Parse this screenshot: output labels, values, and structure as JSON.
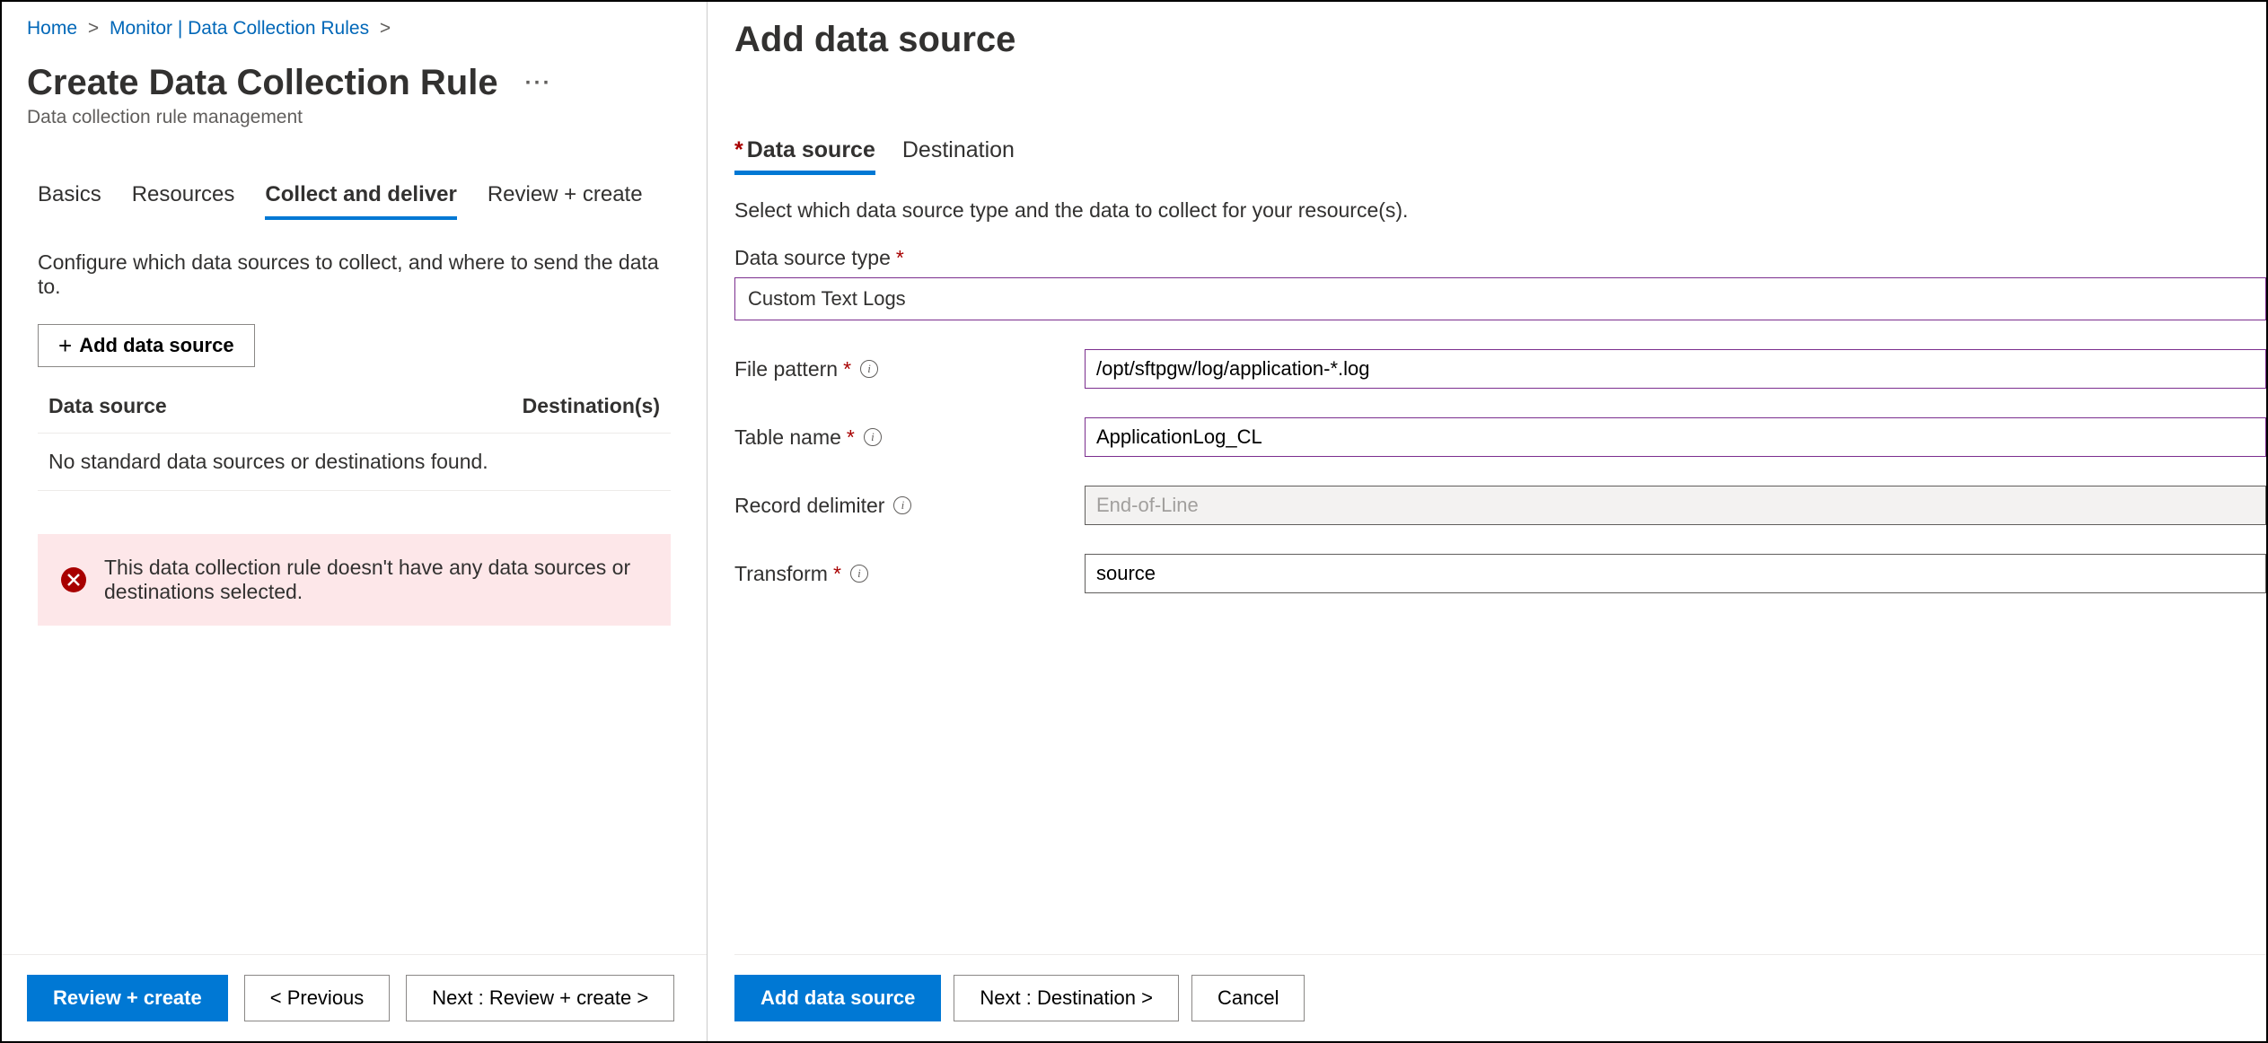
{
  "breadcrumb": {
    "home": "Home",
    "monitor": "Monitor | Data Collection Rules"
  },
  "page": {
    "title": "Create Data Collection Rule",
    "subtitle": "Data collection rule management"
  },
  "tabs": {
    "basics": "Basics",
    "resources": "Resources",
    "collect": "Collect and deliver",
    "review": "Review + create"
  },
  "main": {
    "description": "Configure which data sources to collect, and where to send the data to.",
    "add_button": "Add data source",
    "col_source": "Data source",
    "col_dest": "Destination(s)",
    "empty_row": "No standard data sources or destinations found.",
    "error_msg": "This data collection rule doesn't have any data sources or destinations selected."
  },
  "footer": {
    "review_create": "Review + create",
    "previous": "< Previous",
    "next": "Next : Review + create >"
  },
  "panel": {
    "title": "Add data source",
    "tab_source": "Data source",
    "tab_dest": "Destination",
    "description": "Select which data source type and the data to collect for your resource(s).",
    "type_label": "Data source type",
    "type_value": "Custom Text Logs",
    "file_label": "File pattern",
    "file_value": "/opt/sftpgw/log/application-*.log",
    "table_label": "Table name",
    "table_value": "ApplicationLog_CL",
    "record_label": "Record delimiter",
    "record_value": "End-of-Line",
    "transform_label": "Transform",
    "transform_value": "source"
  },
  "panel_footer": {
    "add": "Add data source",
    "next": "Next : Destination >",
    "cancel": "Cancel"
  }
}
